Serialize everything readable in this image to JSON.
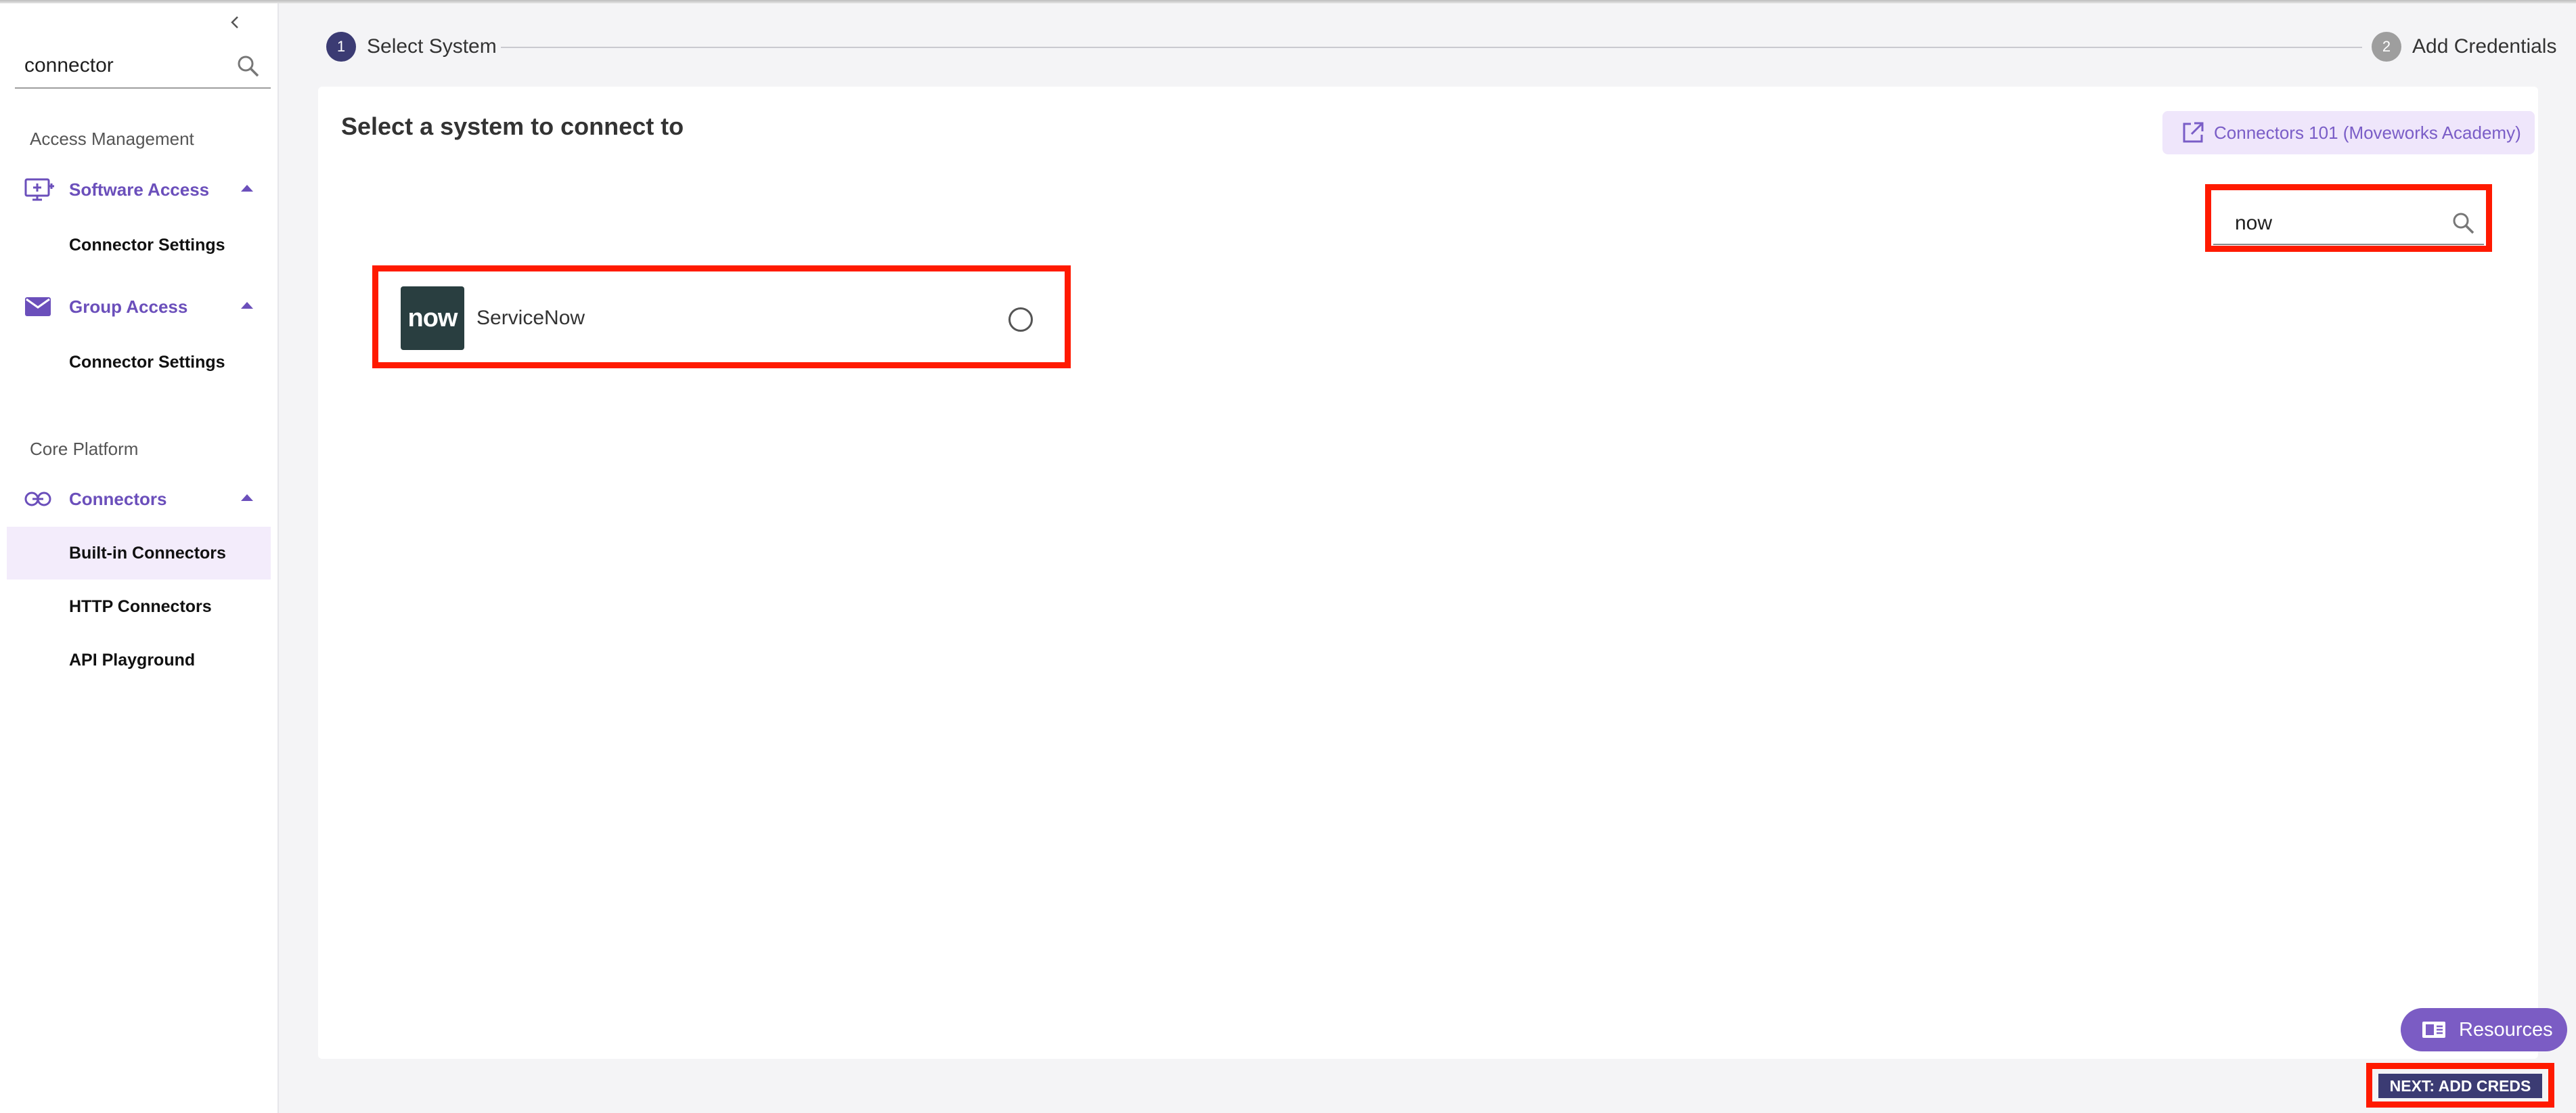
{
  "sidebar": {
    "search_value": "connector",
    "sections": [
      {
        "title": "Access Management",
        "groups": [
          {
            "label": "Software Access",
            "icon": "monitor-plus-icon",
            "items": [
              "Connector Settings"
            ]
          },
          {
            "label": "Group Access",
            "icon": "mail-icon",
            "items": [
              "Connector Settings"
            ]
          }
        ]
      },
      {
        "title": "Core Platform",
        "groups": [
          {
            "label": "Connectors",
            "icon": "link-icon",
            "items": [
              "Built-in Connectors",
              "HTTP Connectors",
              "API Playground"
            ],
            "active_item": "Built-in Connectors"
          }
        ]
      }
    ]
  },
  "stepper": {
    "steps": [
      {
        "number": "1",
        "label": "Select System",
        "active": true
      },
      {
        "number": "2",
        "label": "Add Credentials",
        "active": false
      }
    ]
  },
  "main": {
    "title": "Select a system to connect to",
    "academy_link": "Connectors 101 (Moveworks Academy)",
    "search_value": "now",
    "systems": [
      {
        "name": "ServiceNow",
        "logo_text": "now",
        "selected": false
      }
    ]
  },
  "footer": {
    "resources_label": "Resources",
    "next_label": "NEXT: ADD CREDS"
  },
  "colors": {
    "accent": "#6b4fbb",
    "step_active": "#3b3b73",
    "step_inactive": "#9e9e9e",
    "highlight": "#ff1a00",
    "active_bg": "#f3ecfb"
  }
}
